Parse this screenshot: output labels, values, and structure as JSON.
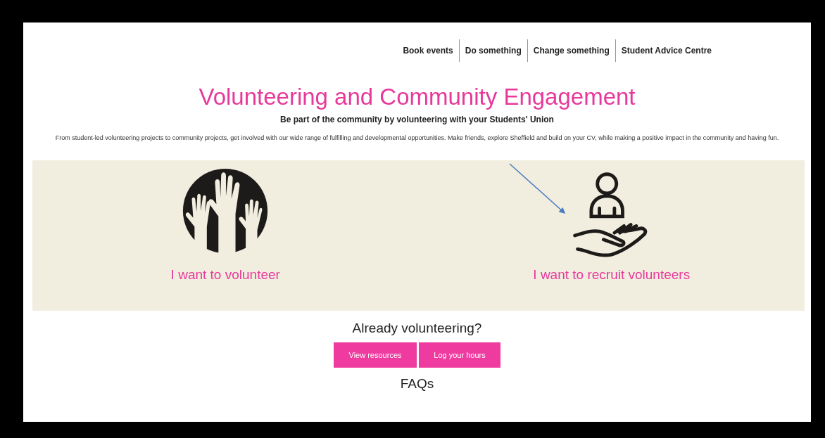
{
  "nav": [
    {
      "label": "Book events"
    },
    {
      "label": "Do something"
    },
    {
      "label": "Change something"
    },
    {
      "label": "Student Advice Centre"
    }
  ],
  "title": "Volunteering and Community Engagement",
  "subtitle": "Be part of the community by volunteering with your Students' Union",
  "intro": "From student-led volunteering projects to community projects, get involved with our wide range of fulfilling and developmental opportunities. Make friends, explore Sheffield and build on your CV, while making a positive impact in the community and having fun.",
  "options": [
    {
      "kind": "volunteer",
      "label": "I want to volunteer"
    },
    {
      "kind": "recruit",
      "label": "I want to recruit volunteers"
    }
  ],
  "already": {
    "heading": "Already volunteering?",
    "buttons": [
      "View resources",
      "Log your hours"
    ]
  },
  "faqs": "FAQs"
}
